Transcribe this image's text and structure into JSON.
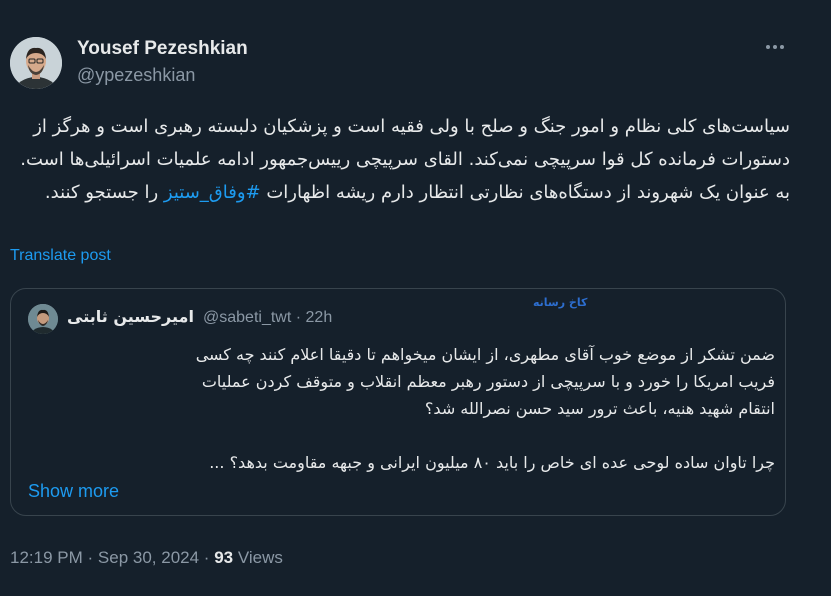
{
  "author": {
    "name": "Yousef Pezeshkian",
    "handle": "@ypezeshkian"
  },
  "tweet": {
    "text_before": "سیاست‌های کلی نظام و امور جنگ و صلح با ولی فقیه است و پزشکیان دلبسته رهبری است و هرگز از دستورات فرمانده کل قوا سرپیچی نمی‌کند. القای سرپیچی رییس‌جمهور ادامه علمیات اسرائیلی‌ها است. به عنوان یک شهروند از دستگاه‌های نظارتی انتظار دارم ریشه اظهارات ",
    "hashtag": "#وفاق_ستیز",
    "text_after": " را جستجو کنند.",
    "translate_label": "Translate post"
  },
  "quote": {
    "author_name": "امیرحسین ثابتی",
    "author_handle": "@sabeti_twt",
    "time_ago": "22h",
    "separator": "·",
    "watermark": "کاخ رسانه",
    "lines": [
      "ضمن تشکر از موضع خوب آقای مطهری، از ایشان میخواهم تا دقیقا اعلام کنند چه کسی",
      "فریب امریکا را خورد و با سرپیچی از دستور رهبر معظم انقلاب و متوقف کردن عملیات",
      "انتقام شهید هنیه، باعث ترور سید حسن نصرالله شد؟"
    ],
    "last_line": "چرا تاوان ساده لوحی عده ای خاص را باید ۸۰ میلیون ایرانی و جبهه مقاومت بدهد؟ ...",
    "show_more": "Show more"
  },
  "footer": {
    "time": "12:19 PM",
    "date": "Sep 30, 2024",
    "views_count": "93",
    "views_label": "Views",
    "separator": "·"
  },
  "colors": {
    "background": "#15202b",
    "text": "#e7e9ea",
    "secondary": "#8b98a5",
    "accent": "#1d9bf0",
    "border": "#38444d"
  },
  "icons": {
    "more": "more-horizontal-icon"
  }
}
